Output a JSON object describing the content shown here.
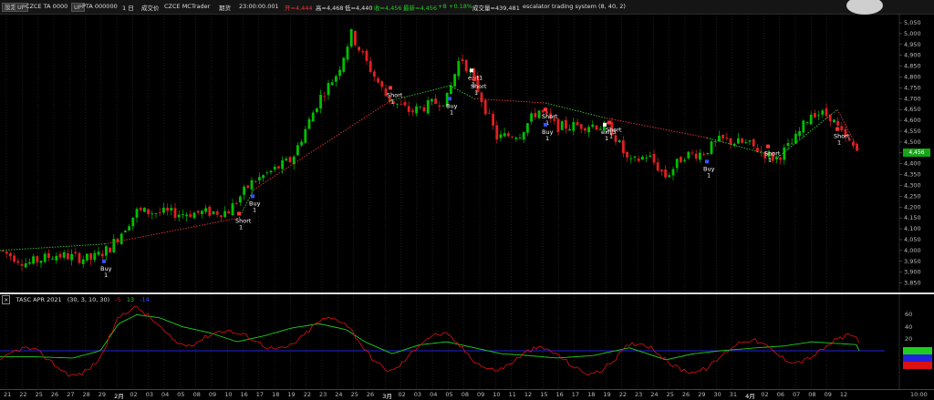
{
  "toolbar": {
    "btn1": "設定",
    "btn2": "UP",
    "symbol1": "CZCE TA 0000",
    "btn3": "UP",
    "symbol2": "PTA 000000",
    "interval": "1 日",
    "session": "成交价",
    "datafeed": "CZCE MCTrader",
    "futures": "期货",
    "time": "23:00:00.001",
    "open": "开=4,444",
    "high": "高=4,468",
    "low": "低=4,440",
    "close": "收=4,456",
    "last": "最新=4,456",
    "change": "+8",
    "pct": "+0.18%",
    "volume": "成交量=439,481",
    "strategy": "escalator trading system (8, 40, 2)"
  },
  "colors": {
    "up": "#00c000",
    "down": "#e02020",
    "green_line": "#1fce1f",
    "red_line": "#d11",
    "blue_line": "#2222dd",
    "trend_green": "#3c3",
    "trend_red": "#e33"
  },
  "price_axis": {
    "ticks": [
      "5,050",
      "5,000",
      "4,950",
      "4,900",
      "4,850",
      "4,800",
      "4,750",
      "4,700",
      "4,650",
      "4,600",
      "4,550",
      "4,500",
      "4,450",
      "4,400",
      "4,350",
      "4,300",
      "4,250",
      "4,200",
      "4,150",
      "4,100",
      "4,050",
      "4,000",
      "3,950",
      "3,900",
      "3,850"
    ],
    "last_price": "4,456"
  },
  "indicator": {
    "title": "TASC APR 2021",
    "params": "(30, 3, 10, 30)",
    "value1": "-5",
    "value2": "13",
    "value3": "-14",
    "ticks": [
      "60",
      "40",
      "20",
      "0",
      "-20"
    ],
    "badge_colors": [
      "#1fce1f",
      "#2222dd",
      "#d11"
    ]
  },
  "x_axis": {
    "labels": [
      "21",
      "22",
      "25",
      "26",
      "27",
      "28",
      "29",
      "2月",
      "02",
      "03",
      "04",
      "05",
      "08",
      "09",
      "10",
      "16",
      "17",
      "18",
      "19",
      "22",
      "23",
      "24",
      "25",
      "26",
      "3月",
      "02",
      "03",
      "04",
      "05",
      "08",
      "09",
      "10",
      "11",
      "12",
      "15",
      "16",
      "17",
      "18",
      "19",
      "22",
      "23",
      "24",
      "25",
      "26",
      "29",
      "30",
      "31",
      "4月",
      "02",
      "06",
      "07",
      "08",
      "09",
      "12",
      "10:00"
    ]
  },
  "signals": [
    {
      "label": "Buy",
      "n": "1"
    },
    {
      "label": "Short",
      "n": "1"
    },
    {
      "label": "Buy",
      "n": "1"
    },
    {
      "label": "Short",
      "n": "1"
    },
    {
      "label": "Buy",
      "n": "1"
    },
    {
      "label": "exit1",
      "n": "1"
    },
    {
      "label": "Short",
      "n": "1"
    },
    {
      "label": "Short",
      "n": "1"
    },
    {
      "label": "Buy",
      "n": "1"
    },
    {
      "label": "exit3",
      "n": "1"
    },
    {
      "label": "Short",
      "n": "1"
    },
    {
      "label": "Buy",
      "n": "1"
    },
    {
      "label": "Short",
      "n": "1"
    },
    {
      "label": "Short",
      "n": "1"
    }
  ]
}
